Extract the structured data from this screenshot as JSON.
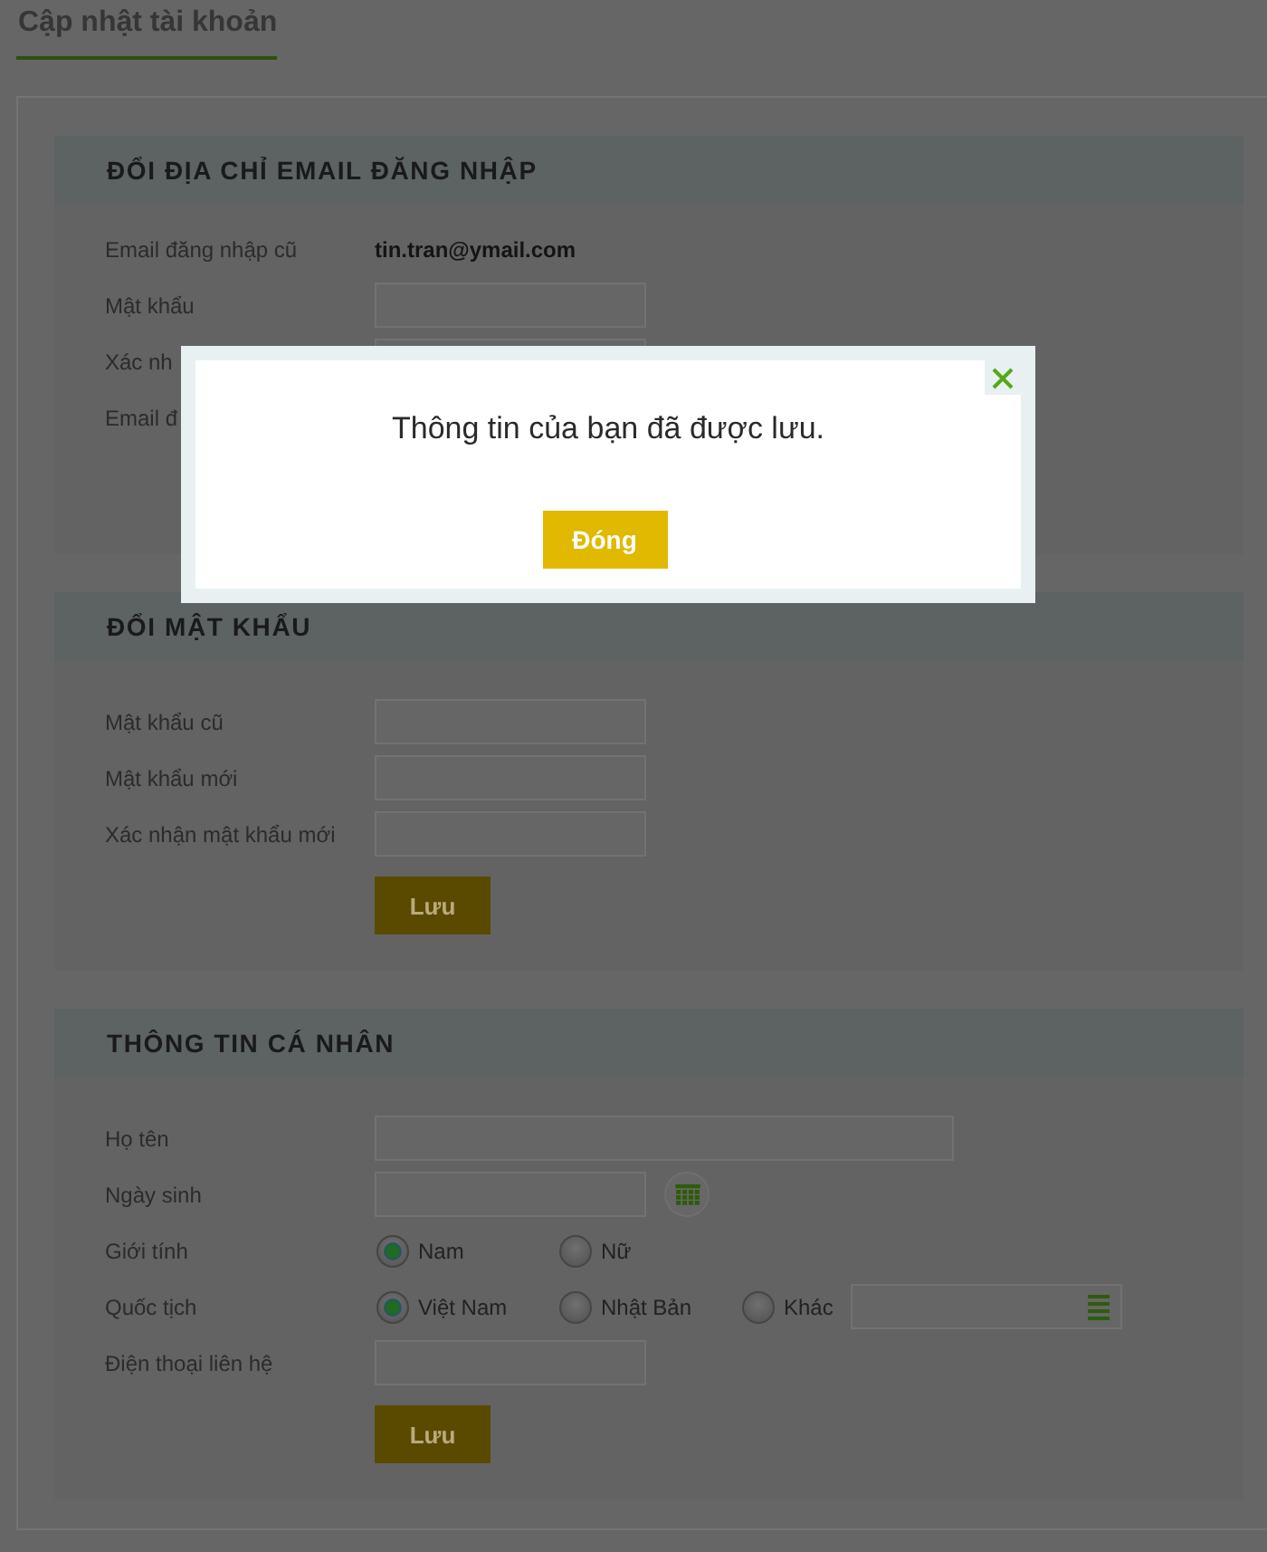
{
  "page_title": "Cập nhật tài khoản",
  "sections": [
    {
      "title": "ĐỔI ĐỊA CHỈ EMAIL ĐĂNG NHẬP",
      "rows": [
        {
          "kind": "value",
          "label": "Email đăng nhập cũ",
          "value": "tin.tran@ymail.com"
        },
        {
          "kind": "input",
          "label": "Mật khẩu"
        },
        {
          "kind": "input",
          "label": "Xác nh"
        },
        {
          "kind": "label",
          "label": "Email đ"
        }
      ]
    },
    {
      "title": "ĐỔI MẬT KHẨU",
      "rows": [
        {
          "kind": "input",
          "label": "Mật khẩu cũ"
        },
        {
          "kind": "input",
          "label": "Mật khẩu mới"
        },
        {
          "kind": "input",
          "label": "Xác nhận mật khẩu mới"
        }
      ],
      "button": "Lưu"
    },
    {
      "title": "THÔNG TIN CÁ NHÂN",
      "rows": [
        {
          "kind": "wide",
          "label": "Họ tên"
        },
        {
          "kind": "date",
          "label": "Ngày sinh"
        },
        {
          "kind": "radio",
          "label": "Giới tính",
          "options": [
            {
              "kind": "plain",
              "label": "Nam",
              "selected": true
            },
            {
              "kind": "plain",
              "label": "Nữ",
              "selected": false
            }
          ]
        },
        {
          "kind": "radio",
          "label": "Quốc tịch",
          "options": [
            {
              "kind": "plain",
              "label": "Việt Nam",
              "selected": true
            },
            {
              "kind": "plain",
              "label": "Nhật Bản",
              "selected": false
            },
            {
              "kind": "other",
              "label": "Khác",
              "selected": false
            }
          ]
        },
        {
          "kind": "input",
          "label": "Điện thoại liên hệ"
        }
      ],
      "button": "Lưu"
    }
  ],
  "dialog": {
    "message": "Thông tin của bạn đã được lưu.",
    "button": "Đóng"
  }
}
